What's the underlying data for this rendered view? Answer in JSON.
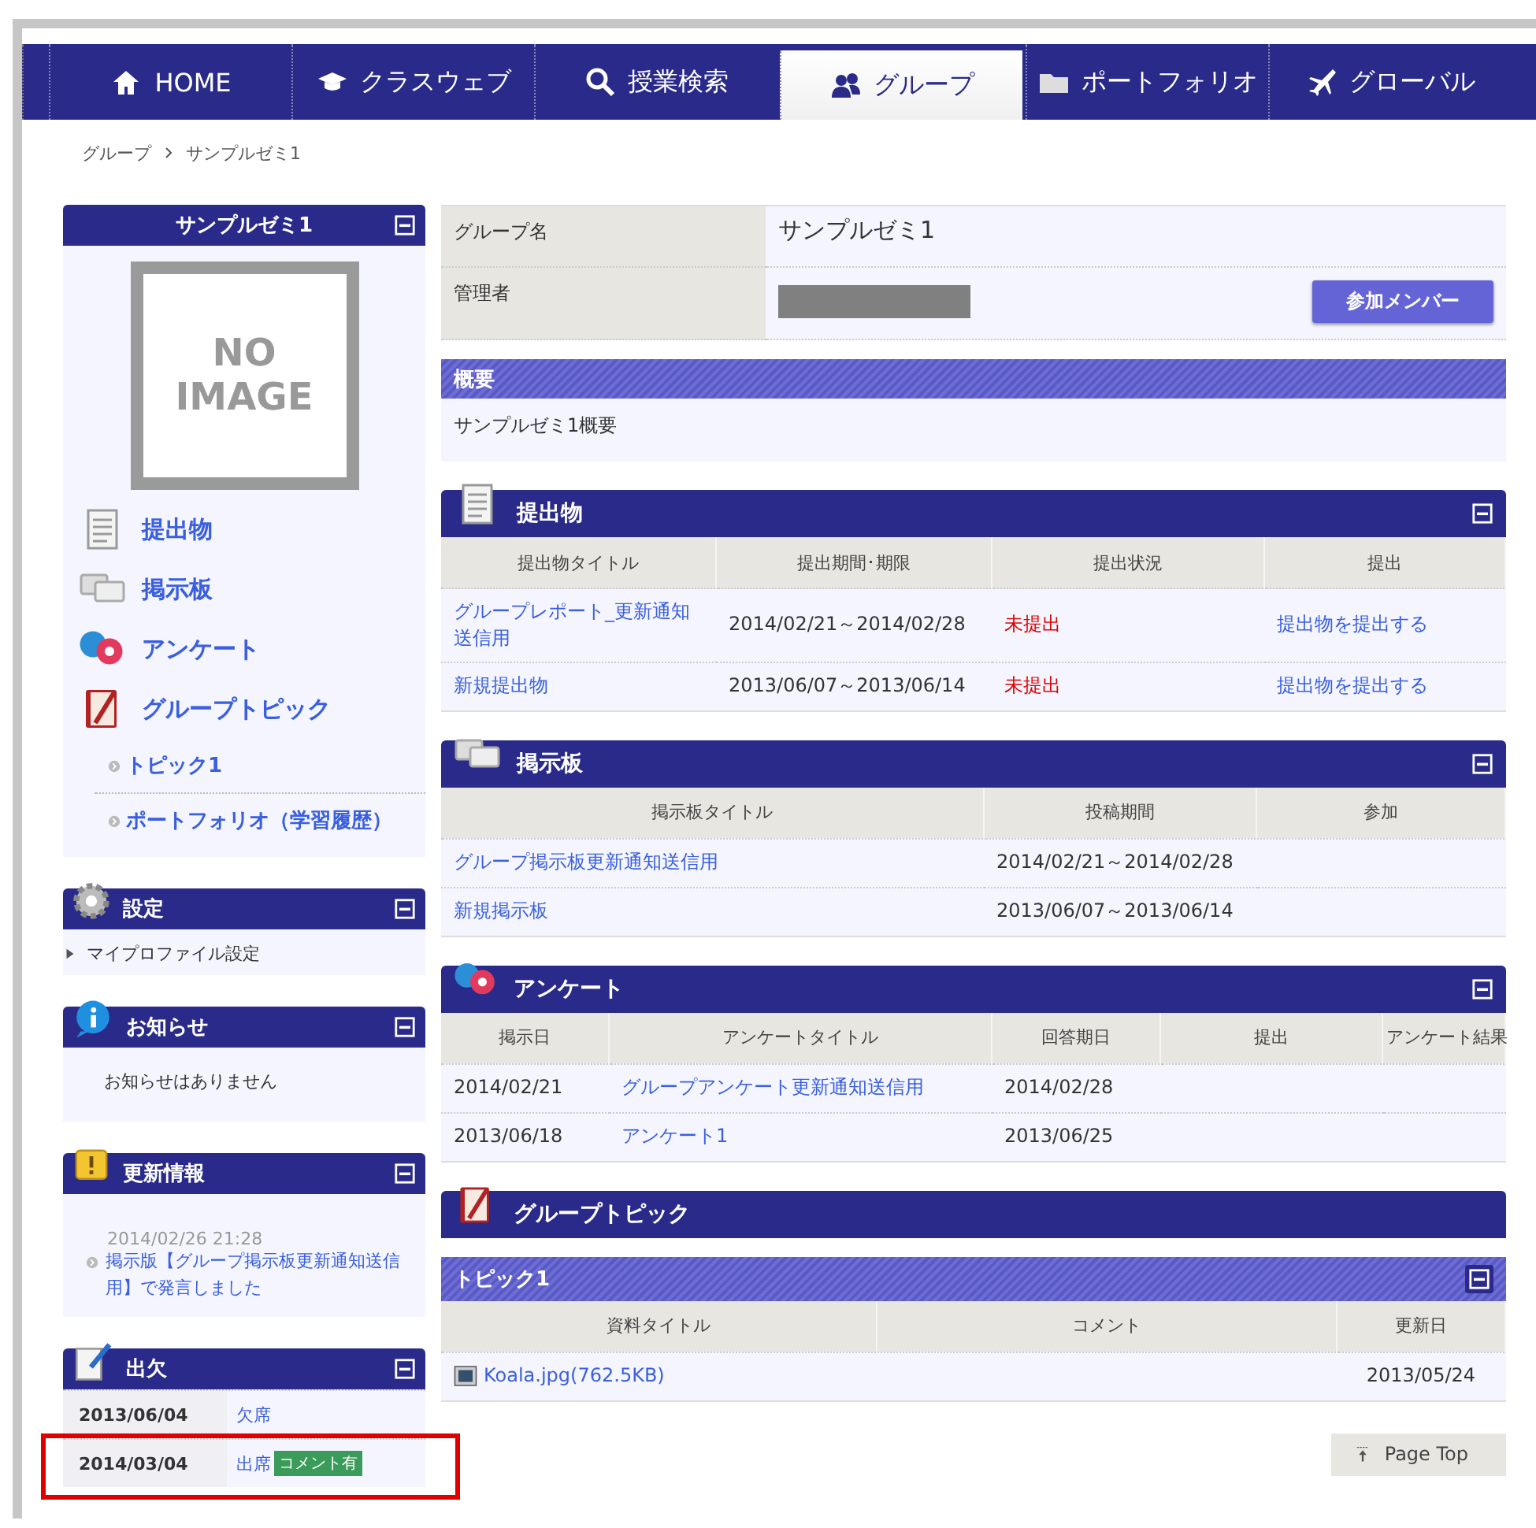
{
  "nav": {
    "tabs": [
      {
        "label": "HOME",
        "selected": false
      },
      {
        "label": "クラスウェブ",
        "selected": false
      },
      {
        "label": "授業検索",
        "selected": false
      },
      {
        "label": "グループ",
        "selected": true
      },
      {
        "label": "ポートフォリオ",
        "selected": false
      },
      {
        "label": "グローバル",
        "selected": false
      }
    ]
  },
  "breadcrumb": [
    "グループ",
    "サンプルゼミ1"
  ],
  "sidebar": {
    "group_panel": {
      "title": "サンプルゼミ1",
      "no_image_text": "NO IMAGE",
      "links": [
        "提出物",
        "掲示板",
        "アンケート",
        "グループトピック"
      ],
      "sub_links": [
        "トピック1",
        "ポートフォリオ（学習履歴）"
      ]
    },
    "settings": {
      "title": "設定",
      "items": [
        "マイプロファイル設定"
      ]
    },
    "notices": {
      "title": "お知らせ",
      "message": "お知らせはありません"
    },
    "updates": {
      "title": "更新情報",
      "entries": [
        {
          "time": "2014/02/26 21:28",
          "text": "掲示版【グループ掲示板更新通知送信用】で発言しました"
        }
      ]
    },
    "attendance": {
      "title": "出欠",
      "rows": [
        {
          "date": "2013/06/04",
          "status": "欠席",
          "highlighted": false
        },
        {
          "date": "2014/03/04",
          "status": "出席",
          "badge": "コメント有",
          "highlighted": true
        }
      ]
    }
  },
  "main": {
    "group_info": {
      "name_label": "グループ名",
      "name": "サンプルゼミ1",
      "admin_label": "管理者",
      "admin_redacted": true,
      "member_button": "参加メンバー"
    },
    "overview": {
      "title": "概要",
      "text": "サンプルゼミ1概要"
    },
    "submissions": {
      "title": "提出物",
      "columns": [
        "提出物タイトル",
        "提出期間･期限",
        "提出状況",
        "提出"
      ],
      "rows": [
        {
          "title": "グループレポート_更新通知送信用",
          "period": "2014/02/21～2014/02/28",
          "status": "未提出",
          "submitted": false,
          "action": "提出物を提出する"
        },
        {
          "title": "新規提出物",
          "period": "2013/06/07～2013/06/14",
          "status": "未提出",
          "submitted": false,
          "action": "提出物を提出する"
        }
      ]
    },
    "boards": {
      "title": "掲示板",
      "columns": [
        "掲示板タイトル",
        "投稿期間",
        "参加"
      ],
      "rows": [
        {
          "title": "グループ掲示板更新通知送信用",
          "period": "2014/02/21～2014/02/28"
        },
        {
          "title": "新規掲示板",
          "period": "2013/06/07～2013/06/14"
        }
      ]
    },
    "surveys": {
      "title": "アンケート",
      "columns": [
        "掲示日",
        "アンケートタイトル",
        "回答期日",
        "提出",
        "アンケート結果"
      ],
      "rows": [
        {
          "posted": "2014/02/21",
          "title": "グループアンケート更新通知送信用",
          "due": "2014/02/28"
        },
        {
          "posted": "2013/06/18",
          "title": "アンケート1",
          "due": "2013/06/25"
        }
      ]
    },
    "topic": {
      "title": "グループトピック",
      "sections": [
        {
          "title": "トピック1",
          "columns": [
            "資料タイトル",
            "コメント",
            "更新日"
          ],
          "rows": [
            {
              "file": "Koala.jpg(762.5KB)",
              "updated": "2013/05/24"
            }
          ]
        }
      ]
    },
    "page_top": "Page Top"
  }
}
